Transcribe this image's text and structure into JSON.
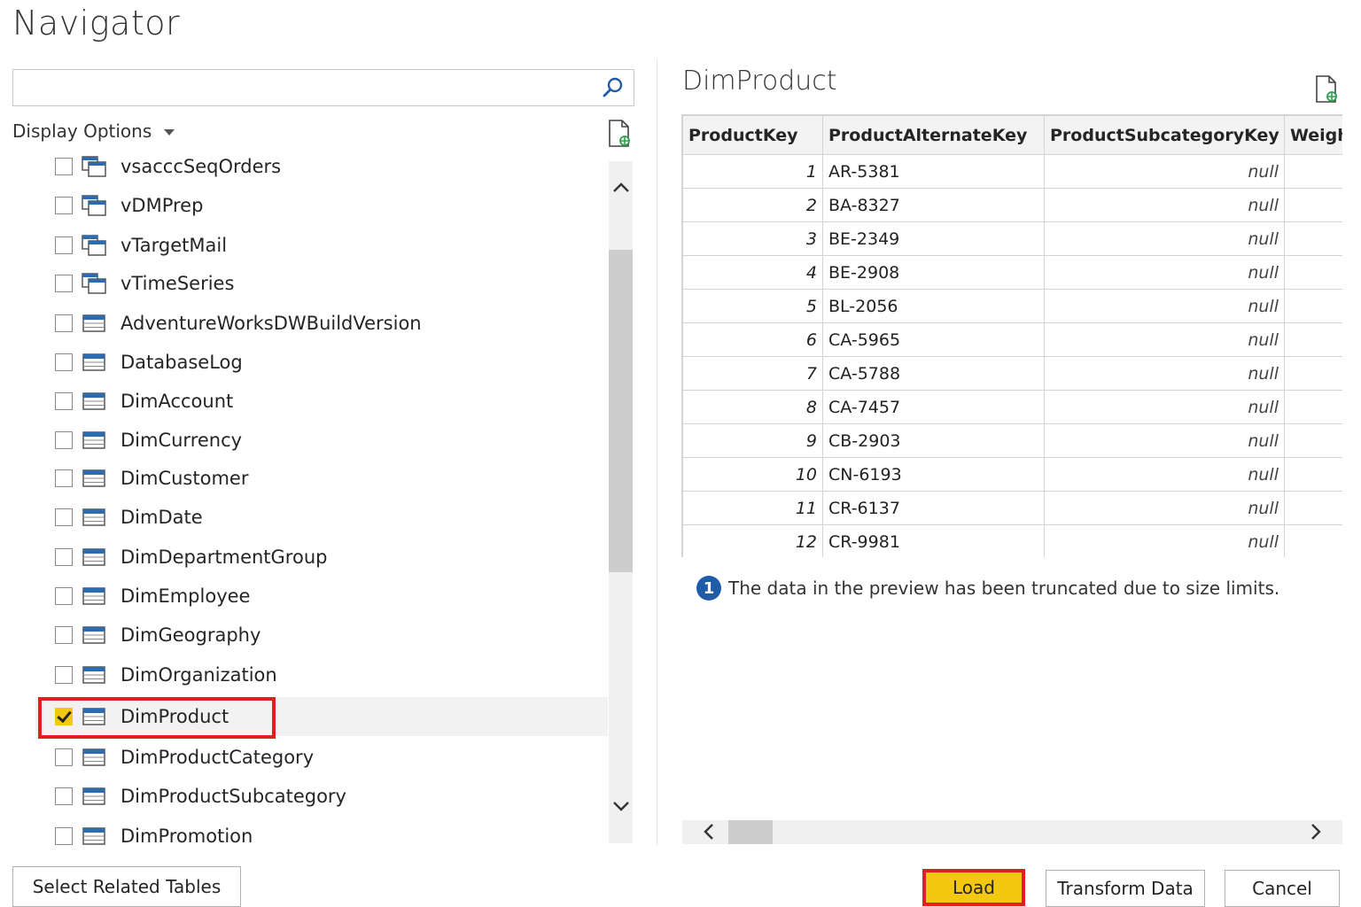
{
  "title": "Navigator",
  "search": {
    "value": "",
    "placeholder": ""
  },
  "display_options": {
    "label": "Display Options"
  },
  "icons": {
    "search": "search-icon",
    "refresh": "refresh-icon",
    "view": "view-icon",
    "table": "table-icon",
    "info": "info-icon"
  },
  "colors": {
    "accent_yellow": "#f2c811",
    "highlight_red": "#e02020",
    "info_blue": "#1f5ca8"
  },
  "list": {
    "items": [
      {
        "label": "vsacccSeqOrders",
        "type": "view",
        "checked": false,
        "selected": false
      },
      {
        "label": "vDMPrep",
        "type": "view",
        "checked": false,
        "selected": false
      },
      {
        "label": "vTargetMail",
        "type": "view",
        "checked": false,
        "selected": false
      },
      {
        "label": "vTimeSeries",
        "type": "view",
        "checked": false,
        "selected": false
      },
      {
        "label": "AdventureWorksDWBuildVersion",
        "type": "table",
        "checked": false,
        "selected": false
      },
      {
        "label": "DatabaseLog",
        "type": "table",
        "checked": false,
        "selected": false
      },
      {
        "label": "DimAccount",
        "type": "table",
        "checked": false,
        "selected": false
      },
      {
        "label": "DimCurrency",
        "type": "table",
        "checked": false,
        "selected": false
      },
      {
        "label": "DimCustomer",
        "type": "table",
        "checked": false,
        "selected": false
      },
      {
        "label": "DimDate",
        "type": "table",
        "checked": false,
        "selected": false
      },
      {
        "label": "DimDepartmentGroup",
        "type": "table",
        "checked": false,
        "selected": false
      },
      {
        "label": "DimEmployee",
        "type": "table",
        "checked": false,
        "selected": false
      },
      {
        "label": "DimGeography",
        "type": "table",
        "checked": false,
        "selected": false
      },
      {
        "label": "DimOrganization",
        "type": "table",
        "checked": false,
        "selected": false
      },
      {
        "label": "DimProduct",
        "type": "table",
        "checked": true,
        "selected": true
      },
      {
        "label": "DimProductCategory",
        "type": "table",
        "checked": false,
        "selected": false
      },
      {
        "label": "DimProductSubcategory",
        "type": "table",
        "checked": false,
        "selected": false
      },
      {
        "label": "DimPromotion",
        "type": "table",
        "checked": false,
        "selected": false
      }
    ]
  },
  "preview": {
    "title": "DimProduct",
    "columns": [
      "ProductKey",
      "ProductAlternateKey",
      "ProductSubcategoryKey",
      "Weigh"
    ],
    "rows": [
      [
        "1",
        "AR-5381",
        "null",
        ""
      ],
      [
        "2",
        "BA-8327",
        "null",
        ""
      ],
      [
        "3",
        "BE-2349",
        "null",
        ""
      ],
      [
        "4",
        "BE-2908",
        "null",
        ""
      ],
      [
        "5",
        "BL-2056",
        "null",
        ""
      ],
      [
        "6",
        "CA-5965",
        "null",
        ""
      ],
      [
        "7",
        "CA-5788",
        "null",
        ""
      ],
      [
        "8",
        "CA-7457",
        "null",
        ""
      ],
      [
        "9",
        "CB-2903",
        "null",
        ""
      ],
      [
        "10",
        "CN-6193",
        "null",
        ""
      ],
      [
        "11",
        "CR-6137",
        "null",
        ""
      ],
      [
        "12",
        "CR-9981",
        "null",
        ""
      ]
    ],
    "notice": "The data in the preview has been truncated due to size limits.",
    "info_number": "1"
  },
  "buttons": {
    "select_related": "Select Related Tables",
    "load": "Load",
    "transform": "Transform Data",
    "cancel": "Cancel"
  }
}
